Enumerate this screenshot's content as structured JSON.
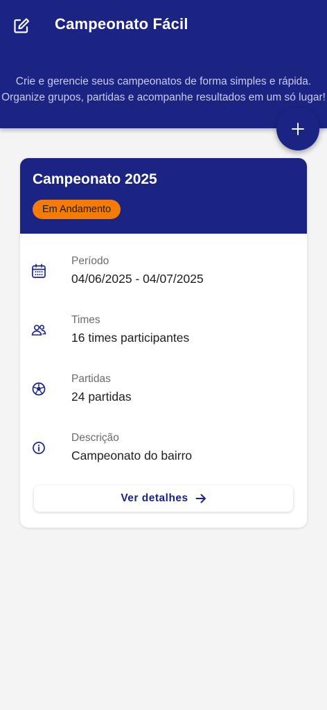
{
  "header": {
    "title": "Campeonato Fácil",
    "subtitle_lines": [
      "Crie e gerencie seus campeonatos de forma simples e rápida.",
      "Organize grupos, partidas e acompanhe resultados em um só lugar!"
    ],
    "edit_icon": "edit-icon",
    "background": "#1b2482"
  },
  "fab": {
    "icon": "plus-icon"
  },
  "card": {
    "title": "Campeonato 2025",
    "status": "Em Andamento",
    "status_color": "#f57c00",
    "rows": [
      {
        "icon": "calendar-icon",
        "label": "Período",
        "value": "04/06/2025 - 04/07/2025"
      },
      {
        "icon": "people-icon",
        "label": "Times",
        "value": "16 times participantes"
      },
      {
        "icon": "soccer-ball-icon",
        "label": "Partidas",
        "value": "24 partidas"
      },
      {
        "icon": "info-icon",
        "label": "Descrição",
        "value": "Campeonato do bairro"
      }
    ],
    "details_label": "Ver detalhes",
    "details_icon": "arrow-right-icon"
  }
}
